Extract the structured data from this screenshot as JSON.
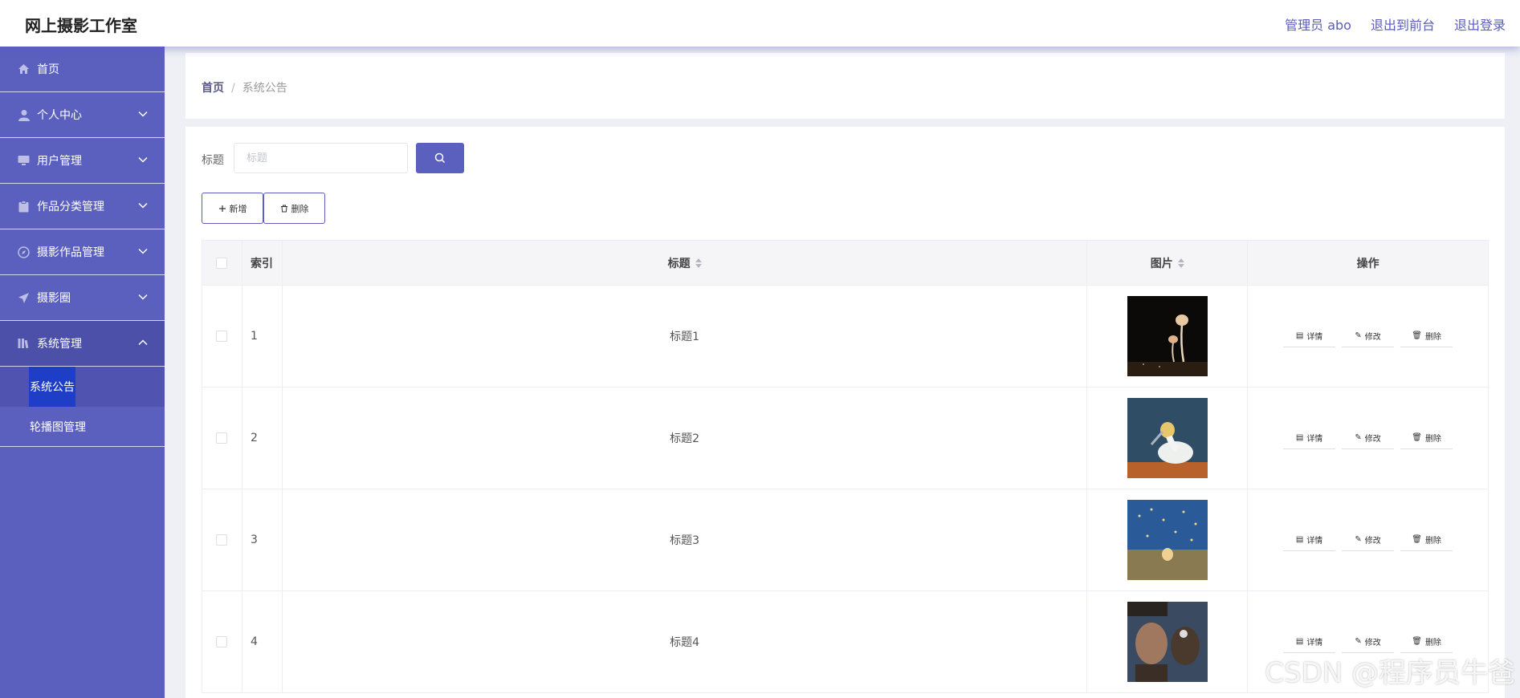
{
  "app": {
    "title": "网上摄影工作室"
  },
  "topbar": {
    "links": [
      "管理员 abo",
      "退出到前台",
      "退出登录"
    ]
  },
  "sidebar": {
    "items": [
      {
        "label": "首页",
        "icon": "home-icon",
        "expandable": false
      },
      {
        "label": "个人中心",
        "icon": "user-icon",
        "expandable": true
      },
      {
        "label": "用户管理",
        "icon": "monitor-icon",
        "expandable": true
      },
      {
        "label": "作品分类管理",
        "icon": "clipboard-icon",
        "expandable": true
      },
      {
        "label": "摄影作品管理",
        "icon": "compass-icon",
        "expandable": true
      },
      {
        "label": "摄影圈",
        "icon": "send-icon",
        "expandable": true
      },
      {
        "label": "系统管理",
        "icon": "library-icon",
        "expandable": true,
        "open": true
      }
    ],
    "submenu": [
      "系统公告",
      "轮播图管理"
    ],
    "active": "系统公告"
  },
  "breadcrumb": {
    "home": "首页",
    "separator": "/",
    "current": "系统公告"
  },
  "search": {
    "label": "标题",
    "placeholder": "标题",
    "value": ""
  },
  "actions": {
    "add": "新增",
    "delete": "删除"
  },
  "table": {
    "headers": {
      "index": "索引",
      "title": "标题",
      "image": "图片",
      "ops": "操作"
    },
    "rows": [
      {
        "index": "1",
        "title": "标题1",
        "image": "mushroom-photo"
      },
      {
        "index": "2",
        "title": "标题2",
        "image": "gannet-bird-photo"
      },
      {
        "index": "3",
        "title": "标题3",
        "image": "bird-in-field-photo"
      },
      {
        "index": "4",
        "title": "标题4",
        "image": "man-with-eagle-photo"
      }
    ],
    "row_ops": {
      "detail": "详情",
      "edit": "修改",
      "delete": "删除"
    }
  },
  "watermark": "CSDN @程序员牛爸",
  "colors": {
    "accent": "#5b5fbe",
    "active": "#1f3ec8"
  }
}
